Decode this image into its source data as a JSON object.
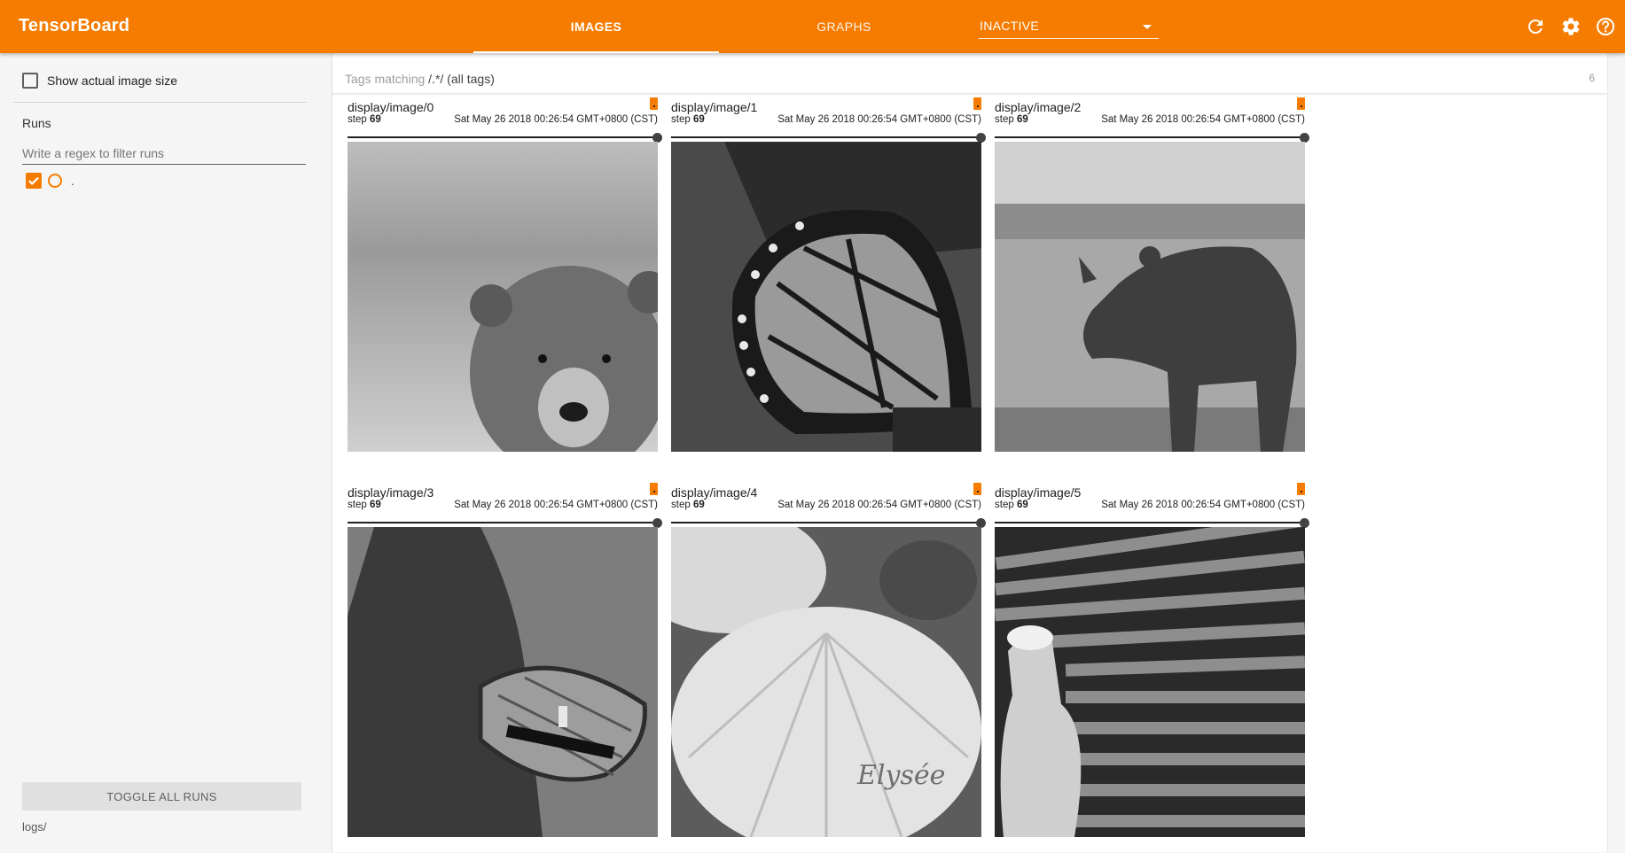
{
  "app": {
    "title": "TensorBoard",
    "accent_color": "#f57c00"
  },
  "nav": {
    "tabs": [
      {
        "label": "IMAGES",
        "active": true
      },
      {
        "label": "GRAPHS",
        "active": false
      }
    ],
    "inactive_dropdown": {
      "selected": "INACTIVE"
    },
    "icons": [
      "refresh-icon",
      "settings-icon",
      "help-icon"
    ]
  },
  "sidebar": {
    "show_actual_size_label": "Show actual image size",
    "show_actual_size_checked": false,
    "runs_title": "Runs",
    "regex_placeholder": "Write a regex to filter runs",
    "runs": [
      {
        "name": ".",
        "checked": true
      }
    ],
    "toggle_button_label": "TOGGLE ALL RUNS",
    "logdir_label": "logs/"
  },
  "main": {
    "tags_prefix": "Tags matching ",
    "tags_regex": "/.*/",
    "tags_suffix": " (all tags)",
    "tag_count": "6",
    "cards": [
      {
        "tag": "display/image/0",
        "step_label": "step ",
        "step": "69",
        "timestamp": "Sat May 26 2018 00:26:54 GMT+0800 (CST)",
        "image_icon": "bear-photo"
      },
      {
        "tag": "display/image/1",
        "step_label": "step ",
        "step": "69",
        "timestamp": "Sat May 26 2018 00:26:54 GMT+0800 (CST)",
        "image_icon": "butterfly-photo"
      },
      {
        "tag": "display/image/2",
        "step_label": "step ",
        "step": "69",
        "timestamp": "Sat May 26 2018 00:26:54 GMT+0800 (CST)",
        "image_icon": "rhino-photo"
      },
      {
        "tag": "display/image/3",
        "step_label": "step ",
        "step": "69",
        "timestamp": "Sat May 26 2018 00:26:54 GMT+0800 (CST)",
        "image_icon": "woman-basket-photo"
      },
      {
        "tag": "display/image/4",
        "step_label": "step ",
        "step": "69",
        "timestamp": "Sat May 26 2018 00:26:54 GMT+0800 (CST)",
        "image_icon": "umbrella-cafe-photo",
        "image_text": "Elysée"
      },
      {
        "tag": "display/image/5",
        "step_label": "step ",
        "step": "69",
        "timestamp": "Sat May 26 2018 00:26:54 GMT+0800 (CST)",
        "image_icon": "lumber-worker-photo"
      }
    ]
  }
}
